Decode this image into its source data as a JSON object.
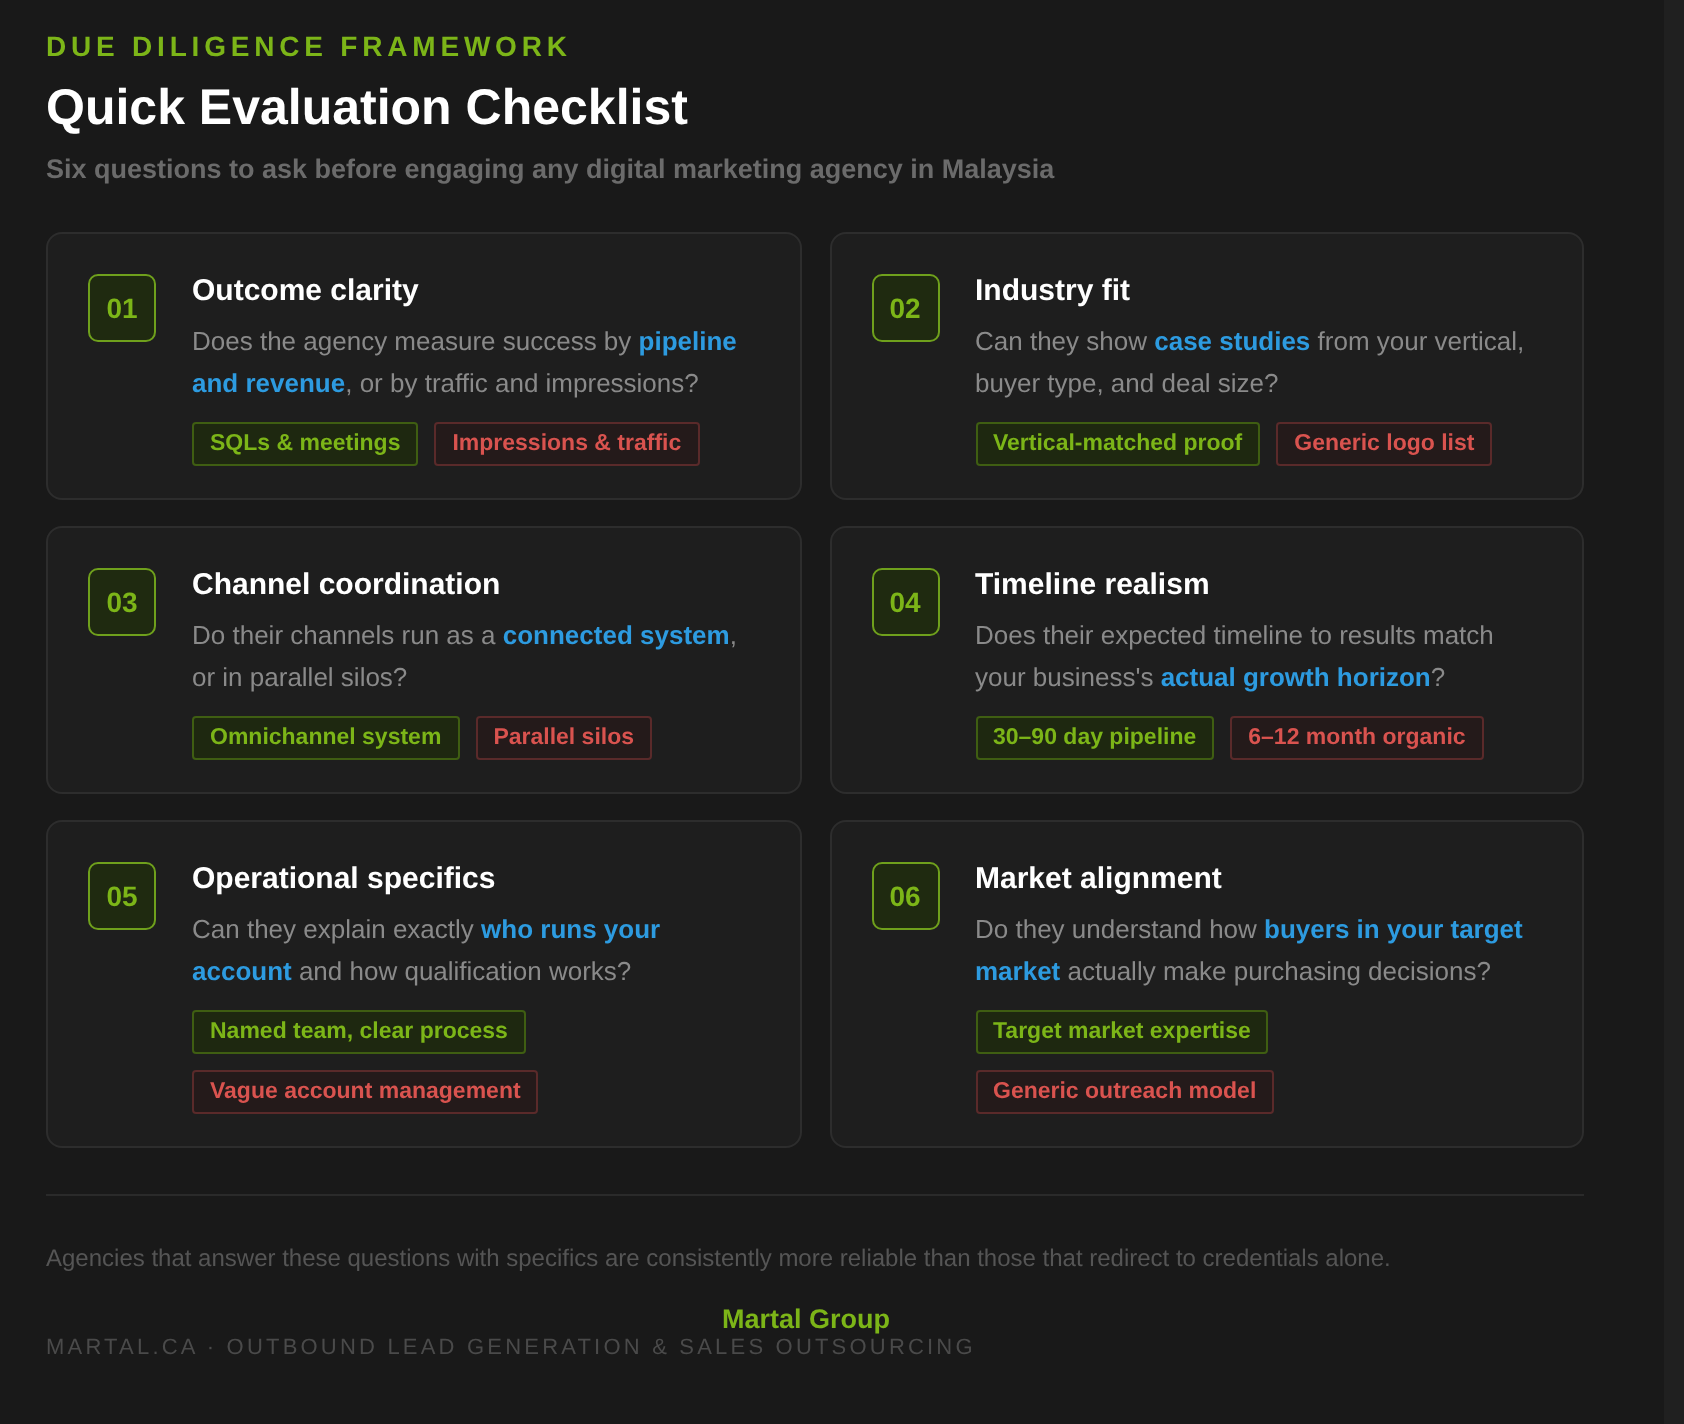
{
  "eyebrow": "DUE DILIGENCE FRAMEWORK",
  "title": "Quick Evaluation Checklist",
  "subtitle": "Six questions to ask before engaging any digital marketing agency in Malaysia",
  "cards": [
    {
      "number": "01",
      "title": "Outcome clarity",
      "question": "Does the agency measure success by **pipeline and revenue**, or by traffic and impressions?",
      "tags": [
        {
          "kind": "good",
          "label": "SQLs & meetings"
        },
        {
          "kind": "bad",
          "label": "Impressions & traffic"
        }
      ]
    },
    {
      "number": "02",
      "title": "Industry fit",
      "question": "Can they show **case studies** from your vertical, buyer type, and deal size?",
      "tags": [
        {
          "kind": "good",
          "label": "Vertical-matched proof"
        },
        {
          "kind": "bad",
          "label": "Generic logo list"
        }
      ]
    },
    {
      "number": "03",
      "title": "Channel coordination",
      "question": "Do their channels run as a **connected system**, or in parallel silos?",
      "tags": [
        {
          "kind": "good",
          "label": "Omnichannel system"
        },
        {
          "kind": "bad",
          "label": "Parallel silos"
        }
      ]
    },
    {
      "number": "04",
      "title": "Timeline realism",
      "question": "Does their expected timeline to results match your business's **actual growth horizon**?",
      "tags": [
        {
          "kind": "good",
          "label": "30–90 day pipeline"
        },
        {
          "kind": "bad",
          "label": "6–12 month organic"
        }
      ]
    },
    {
      "number": "05",
      "title": "Operational specifics",
      "question": "Can they explain exactly **who runs your account** and how qualification works?",
      "tags": [
        {
          "kind": "good",
          "label": "Named team, clear process"
        },
        {
          "kind": "bad",
          "label": "Vague account management"
        }
      ]
    },
    {
      "number": "06",
      "title": "Market alignment",
      "question": "Do they understand how **buyers in your target market** actually make purchasing decisions?",
      "tags": [
        {
          "kind": "good",
          "label": "Target market expertise"
        },
        {
          "kind": "bad",
          "label": "Generic outreach model"
        }
      ]
    }
  ],
  "footer": {
    "note": "Agencies that answer these questions with specifics are consistently more reliable than those that redirect to credentials alone.",
    "brand": "Martal Group",
    "tagline": "MARTAL.CA · OUTBOUND LEAD GENERATION & SALES OUTSOURCING"
  }
}
